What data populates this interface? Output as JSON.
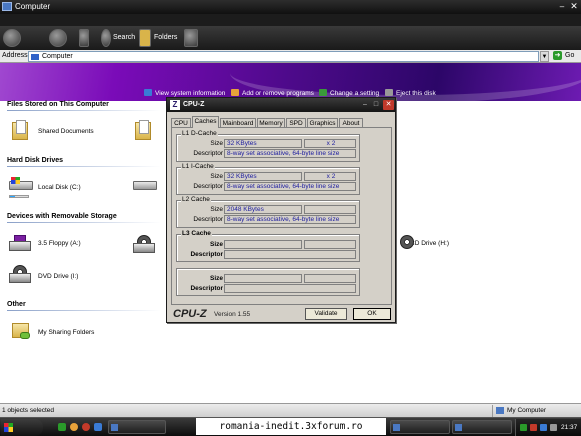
{
  "window": {
    "title": "Computer"
  },
  "toolbar": {
    "search_label": "Search",
    "folders_label": "Folders"
  },
  "address": {
    "label": "Address",
    "value": "Computer",
    "go_label": "Go"
  },
  "tasks": [
    {
      "label": "View system information",
      "color": "#3a7bd5"
    },
    {
      "label": "Add or remove programs",
      "color": "#e8a23a"
    },
    {
      "label": "Change a setting",
      "color": "#3a9a3a"
    },
    {
      "label": "Eject this disk",
      "color": "#999999"
    }
  ],
  "sections": {
    "files": {
      "heading": "Files Stored on This Computer",
      "items": [
        {
          "label": "Shared Documents"
        }
      ]
    },
    "hdd": {
      "heading": "Hard Disk Drives",
      "items": [
        {
          "label": "Local Disk (C:)",
          "usage": 0.3
        }
      ]
    },
    "removable": {
      "heading": "Devices with Removable Storage",
      "items": [
        {
          "label": "3.5 Floppy (A:)"
        },
        {
          "label": "DVD Drive (I:)"
        },
        {
          "label": "CD Drive (H:)"
        }
      ]
    },
    "other": {
      "heading": "Other",
      "items": [
        {
          "label": "My Sharing Folders"
        }
      ]
    }
  },
  "status": {
    "left": "1 objects selected",
    "right": "My Computer"
  },
  "taskbar": {
    "clock": "21:37"
  },
  "watermark": "romania-inedit.3xforum.ro",
  "cpuz": {
    "title": "CPU-Z",
    "tabs": [
      "CPU",
      "Caches",
      "Mainboard",
      "Memory",
      "SPD",
      "Graphics",
      "About"
    ],
    "active_tab": "Caches",
    "l1d": {
      "title": "L1 D-Cache",
      "size_label": "Size",
      "size": "32 KBytes",
      "mult": "x 2",
      "desc_label": "Descriptor",
      "desc": "8-way set associative, 64-byte line size"
    },
    "l1i": {
      "title": "L1 I-Cache",
      "size_label": "Size",
      "size": "32 KBytes",
      "mult": "x 2",
      "desc_label": "Descriptor",
      "desc": "8-way set associative, 64-byte line size"
    },
    "l2": {
      "title": "L2 Cache",
      "size_label": "Size",
      "size": "2048 KBytes",
      "desc_label": "Descriptor",
      "desc": "8-way set associative, 64-byte line size"
    },
    "l3": {
      "title": "L3 Cache",
      "size_label": "Size",
      "desc_label": "Descriptor"
    },
    "extra": {
      "size_label": "Size",
      "desc_label": "Descriptor"
    },
    "logo": "CPU-Z",
    "version": "Version 1.55",
    "validate_label": "Validate",
    "ok_label": "OK"
  }
}
